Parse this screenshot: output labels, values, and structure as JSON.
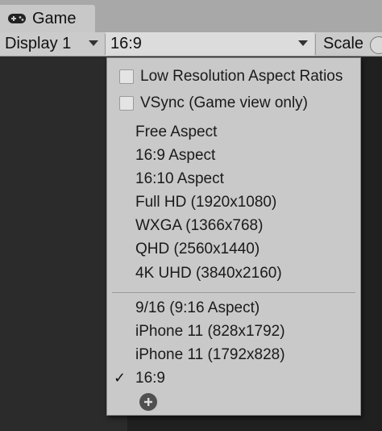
{
  "tab": {
    "title": "Game",
    "icon": "gamepad-icon"
  },
  "toolbar": {
    "display_label": "Display 1",
    "aspect_label": "16:9",
    "scale_label": "Scale"
  },
  "menu": {
    "toggles": [
      {
        "label": "Low Resolution Aspect Ratios",
        "checked": false
      },
      {
        "label": "VSync (Game view only)",
        "checked": false
      }
    ],
    "builtin_items": [
      "Free Aspect",
      "16:9 Aspect",
      "16:10 Aspect",
      "Full HD (1920x1080)",
      "WXGA (1366x768)",
      "QHD (2560x1440)",
      "4K UHD (3840x2160)"
    ],
    "custom_items": [
      "9/16 (9:16 Aspect)",
      "iPhone 11 (828x1792)",
      "iPhone 11 (1792x828)",
      "16:9"
    ],
    "selected": "16:9",
    "check_glyph": "✓",
    "add_icon": "plus-circle-icon"
  },
  "colors": {
    "menu_bg": "#c9c9c9",
    "toolbar_bg": "#cbcbcb",
    "tab_bar_bg": "#a8a8a8",
    "game_view_bg": "#2b2b2b"
  }
}
